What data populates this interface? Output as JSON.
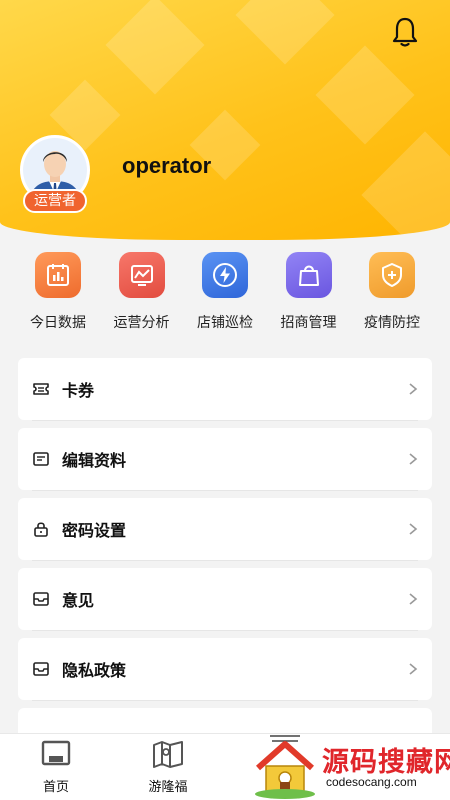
{
  "header": {
    "username": "operator",
    "role_badge": "运营者"
  },
  "quick_actions": [
    {
      "label": "今日数据",
      "icon": "calendar-chart-icon",
      "color": "#f27a3a"
    },
    {
      "label": "运营分析",
      "icon": "trend-chart-icon",
      "color": "#ec5a4c"
    },
    {
      "label": "店铺巡检",
      "icon": "lightning-icon",
      "color": "#3e7ae8"
    },
    {
      "label": "招商管理",
      "icon": "shopping-bag-icon",
      "color": "#7a67e8"
    },
    {
      "label": "疫情防控",
      "icon": "shield-plus-icon",
      "color": "#f3a33a"
    }
  ],
  "menu": [
    {
      "label": "卡券",
      "icon": "ticket-icon"
    },
    {
      "label": "编辑资料",
      "icon": "edit-profile-icon"
    },
    {
      "label": "密码设置",
      "icon": "lock-icon"
    },
    {
      "label": "意见",
      "icon": "feedback-icon"
    },
    {
      "label": "隐私政策",
      "icon": "privacy-icon"
    }
  ],
  "tabs": [
    {
      "label": "首页",
      "icon": "home-icon"
    },
    {
      "label": "游隆福",
      "icon": "map-icon"
    }
  ],
  "watermark": {
    "title": "源码搜藏网",
    "domain": "codesocang.com"
  }
}
